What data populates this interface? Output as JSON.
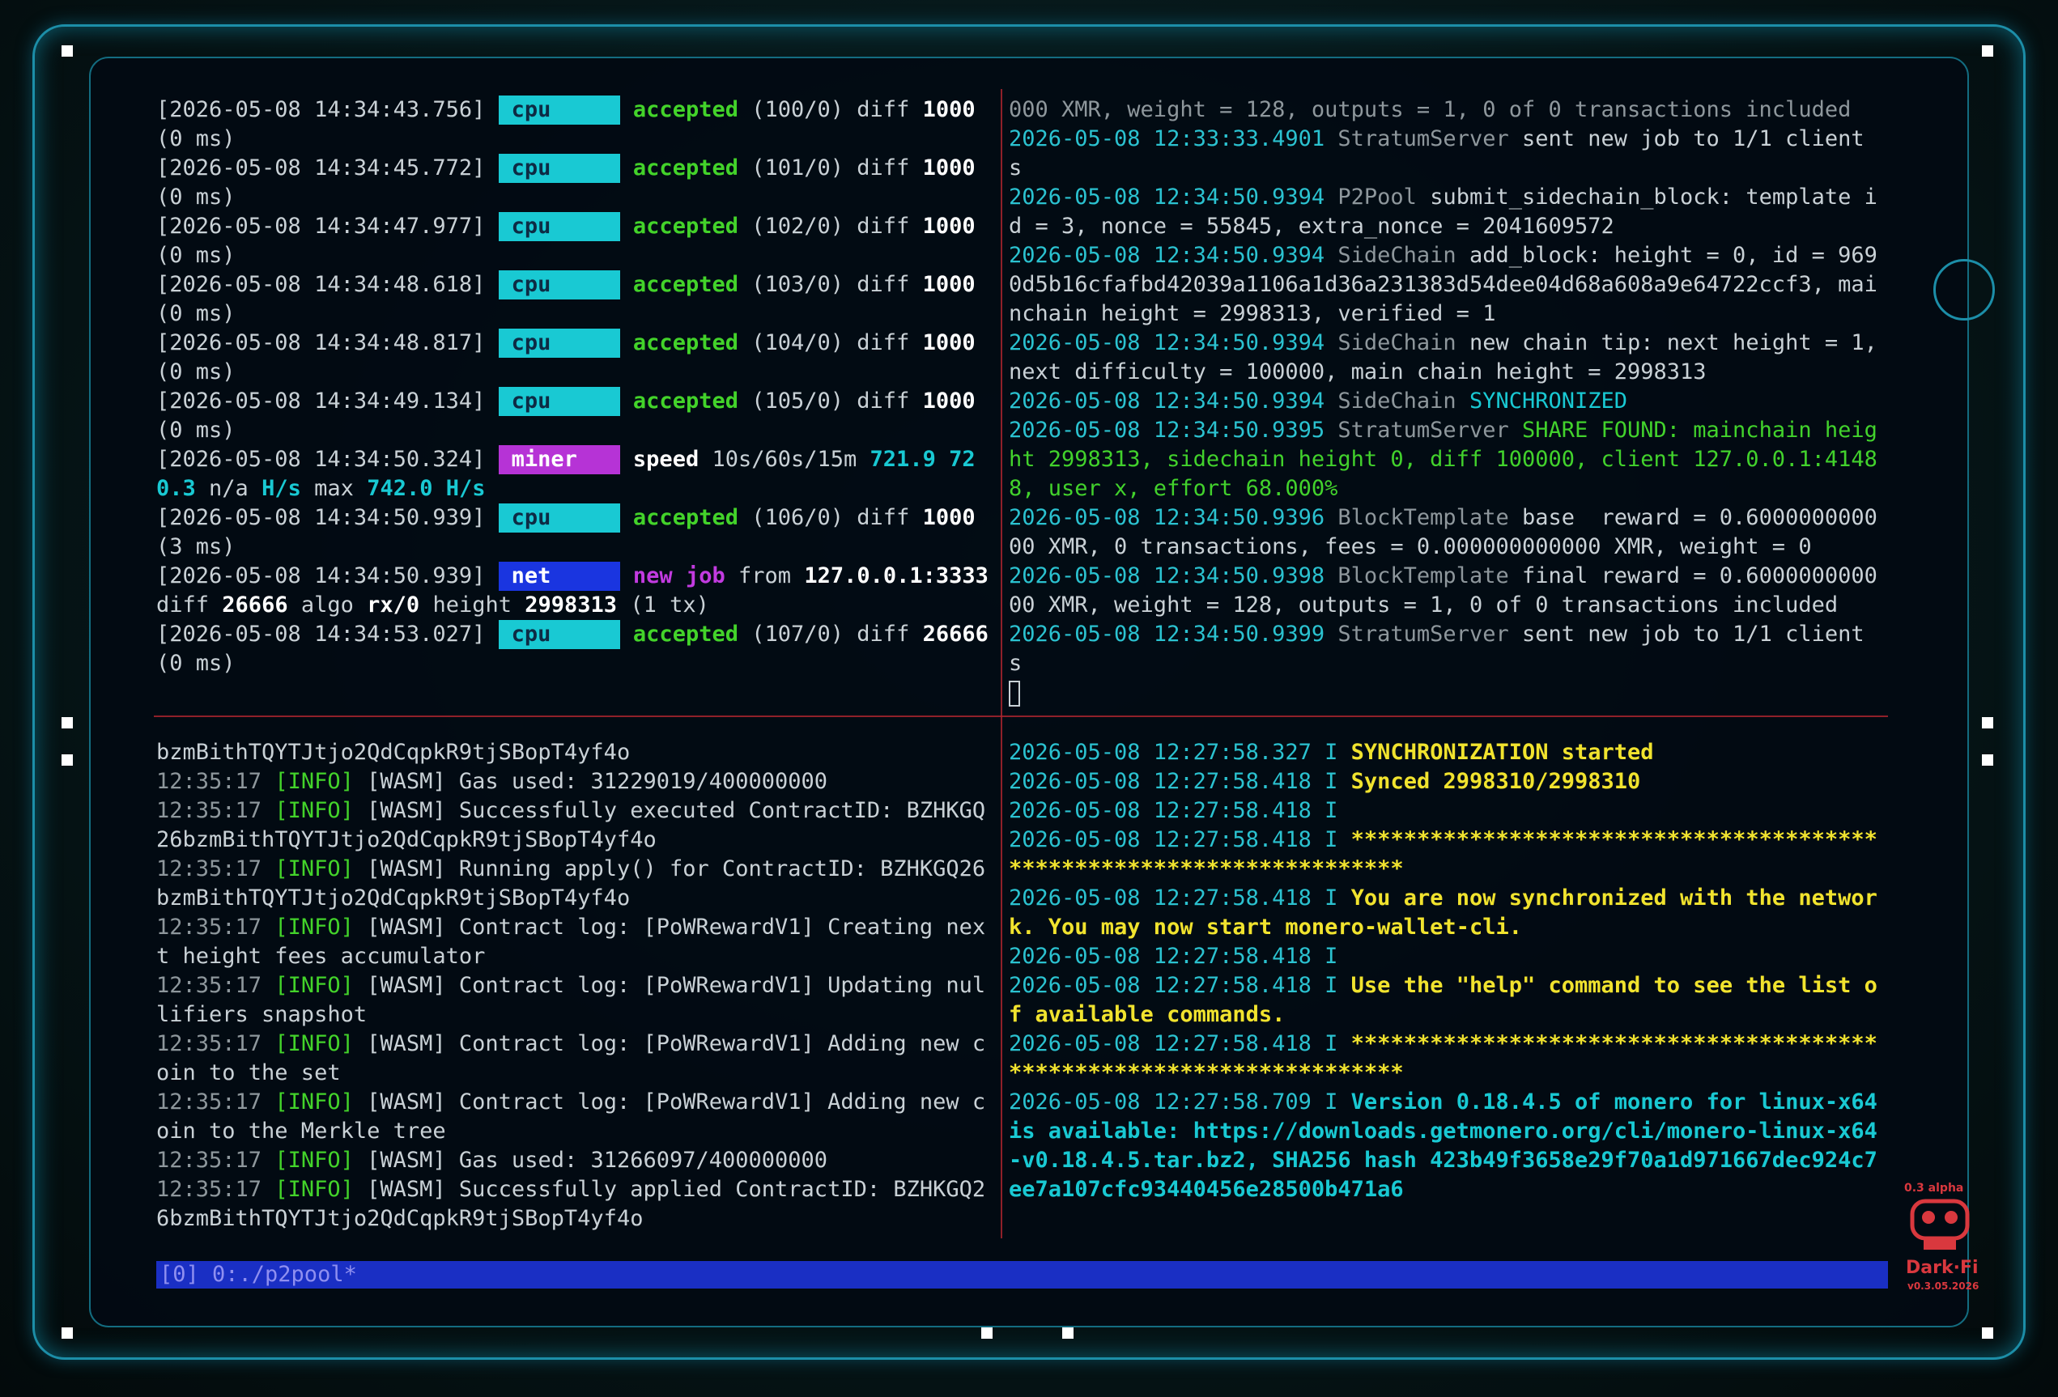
{
  "window": {
    "statusbar": "[0] 0:./p2pool*",
    "logo": {
      "version_top": "0.3 alpha",
      "brand": "Dark·Fi",
      "version_bottom": "v0.3.05.2026"
    }
  },
  "xmrig": {
    "lines": [
      {
        "kind": "accepted",
        "ts": "[2026-05-08 14:34:43.756]",
        "tag": "cpu",
        "label": "accepted",
        "count": "(100/0)",
        "diff_label": "diff",
        "diff": "1000",
        "latency": "(0 ms)"
      },
      {
        "kind": "accepted",
        "ts": "[2026-05-08 14:34:45.772]",
        "tag": "cpu",
        "label": "accepted",
        "count": "(101/0)",
        "diff_label": "diff",
        "diff": "1000",
        "latency": "(0 ms)"
      },
      {
        "kind": "accepted",
        "ts": "[2026-05-08 14:34:47.977]",
        "tag": "cpu",
        "label": "accepted",
        "count": "(102/0)",
        "diff_label": "diff",
        "diff": "1000",
        "latency": "(0 ms)"
      },
      {
        "kind": "accepted",
        "ts": "[2026-05-08 14:34:48.618]",
        "tag": "cpu",
        "label": "accepted",
        "count": "(103/0)",
        "diff_label": "diff",
        "diff": "1000",
        "latency": "(0 ms)"
      },
      {
        "kind": "accepted",
        "ts": "[2026-05-08 14:34:48.817]",
        "tag": "cpu",
        "label": "accepted",
        "count": "(104/0)",
        "diff_label": "diff",
        "diff": "1000",
        "latency": "(0 ms)"
      },
      {
        "kind": "accepted",
        "ts": "[2026-05-08 14:34:49.134]",
        "tag": "cpu",
        "label": "accepted",
        "count": "(105/0)",
        "diff_label": "diff",
        "diff": "1000",
        "latency": "(0 ms)"
      },
      {
        "kind": "speed",
        "ts": "[2026-05-08 14:34:50.324]",
        "tag": "miner",
        "label": "speed",
        "windows": "10s/60s/15m",
        "v1": "721.9",
        "v2": "720.3",
        "v3": "n/a",
        "unit": "H/s",
        "max_label": "max",
        "max": "742.0 H/s"
      },
      {
        "kind": "accepted",
        "ts": "[2026-05-08 14:34:50.939]",
        "tag": "cpu",
        "label": "accepted",
        "count": "(106/0)",
        "diff_label": "diff",
        "diff": "1000",
        "latency": "(3 ms)"
      },
      {
        "kind": "newjob",
        "ts": "[2026-05-08 14:34:50.939]",
        "tag": "net",
        "new": "new",
        "job": "job",
        "from": "from",
        "host": "127.0.0.1:3333",
        "diff_label": "diff",
        "diff": "26666",
        "algo_label": "algo",
        "algo": "rx/0",
        "height_label": "height",
        "height": "2998313",
        "tx": "(1 tx)"
      },
      {
        "kind": "accepted",
        "ts": "[2026-05-08 14:34:53.027]",
        "tag": "cpu",
        "label": "accepted",
        "count": "(107/0)",
        "diff_label": "diff",
        "diff": "26666",
        "latency": "(0 ms)"
      }
    ]
  },
  "p2pool": {
    "lines": [
      {
        "parts": [
          [
            "p2-dim",
            "000 XMR, weight = 128, outputs = 1, 0 of 0 transactions included"
          ]
        ]
      },
      {
        "parts": [
          [
            "p2-ts",
            "2026-05-08 12:33:33.4901 "
          ],
          [
            "p2-mod",
            "StratumServer "
          ],
          [
            "",
            "sent new job to 1/1 client"
          ]
        ]
      },
      {
        "parts": [
          [
            "",
            "s"
          ]
        ]
      },
      {
        "parts": [
          [
            "p2-ts",
            "2026-05-08 12:34:50.9394 "
          ],
          [
            "p2-mod",
            "P2Pool "
          ],
          [
            "",
            "submit_sidechain_block: template id = 3, nonce = 55845, extra_nonce = 2041609572"
          ]
        ]
      },
      {
        "parts": [
          [
            "p2-ts",
            "2026-05-08 12:34:50.9394 "
          ],
          [
            "p2-mod",
            "SideChain "
          ],
          [
            "",
            "add_block: height = 0, id = 9690d5b16cfafbd42039a1106a1d36a231383d54dee04d68a608a9e64722ccf3, mainchain height = 2998313, verified = 1"
          ]
        ]
      },
      {
        "parts": [
          [
            "p2-ts",
            "2026-05-08 12:34:50.9394 "
          ],
          [
            "p2-mod",
            "SideChain "
          ],
          [
            "",
            "new chain tip: next height = 1, next difficulty = 100000, main chain height = 2998313"
          ]
        ]
      },
      {
        "parts": [
          [
            "p2-ts",
            "2026-05-08 12:34:50.9394 "
          ],
          [
            "p2-mod",
            "SideChain "
          ],
          [
            "p2-syn",
            "SYNCHRONIZED"
          ]
        ]
      },
      {
        "parts": [
          [
            "p2-ts",
            "2026-05-08 12:34:50.9395 "
          ],
          [
            "p2-mod",
            "StratumServer "
          ],
          [
            "p2-share",
            "SHARE FOUND: mainchain height 2998313, sidechain height 0, diff 100000, client 127.0.0.1:41488, user x, effort 68.000%"
          ]
        ]
      },
      {
        "parts": [
          [
            "p2-ts",
            "2026-05-08 12:34:50.9396 "
          ],
          [
            "p2-mod",
            "BlockTemplate "
          ],
          [
            "",
            "base  reward = 0.600000000000 XMR, 0 transactions, fees = 0.000000000000 XMR, weight = 0"
          ]
        ]
      },
      {
        "parts": [
          [
            "p2-ts",
            "2026-05-08 12:34:50.9398 "
          ],
          [
            "p2-mod",
            "BlockTemplate "
          ],
          [
            "",
            "final reward = 0.600000000000 XMR, weight = 128, outputs = 1, 0 of 0 transactions included"
          ]
        ]
      },
      {
        "parts": [
          [
            "p2-ts",
            "2026-05-08 12:34:50.9399 "
          ],
          [
            "p2-mod",
            "StratumServer "
          ],
          [
            "",
            "sent new job to 1/1 client"
          ]
        ]
      },
      {
        "parts": [
          [
            "",
            "s"
          ]
        ]
      }
    ]
  },
  "darkfid": {
    "lines": [
      {
        "time": "",
        "level": "",
        "msg": "bzmBithTQYTJtjo2QdCqpkR9tjSBopT4yf4o"
      },
      {
        "time": "12:35:17",
        "level": "[INFO]",
        "msg": "[WASM] Gas used: 31229019/400000000"
      },
      {
        "time": "12:35:17",
        "level": "[INFO]",
        "msg": "[WASM] Successfully executed ContractID: BZHKGQ26bzmBithTQYTJtjo2QdCqpkR9tjSBopT4yf4o"
      },
      {
        "time": "12:35:17",
        "level": "[INFO]",
        "msg": "[WASM] Running apply() for ContractID: BZHKGQ26bzmBithTQYTJtjo2QdCqpkR9tjSBopT4yf4o"
      },
      {
        "time": "12:35:17",
        "level": "[INFO]",
        "msg": "[WASM] Contract log: [PoWRewardV1] Creating next height fees accumulator"
      },
      {
        "time": "12:35:17",
        "level": "[INFO]",
        "msg": "[WASM] Contract log: [PoWRewardV1] Updating nullifiers snapshot"
      },
      {
        "time": "12:35:17",
        "level": "[INFO]",
        "msg": "[WASM] Contract log: [PoWRewardV1] Adding new coin to the set"
      },
      {
        "time": "12:35:17",
        "level": "[INFO]",
        "msg": "[WASM] Contract log: [PoWRewardV1] Adding new coin to the Merkle tree"
      },
      {
        "time": "12:35:17",
        "level": "[INFO]",
        "msg": "[WASM] Gas used: 31266097/400000000"
      },
      {
        "time": "12:35:17",
        "level": "[INFO]",
        "msg": "[WASM] Successfully applied ContractID: BZHKGQ26bzmBithTQYTJtjo2QdCqpkR9tjSBopT4yf4o"
      }
    ]
  },
  "monerod": {
    "lines": [
      {
        "ts": "2026-05-08 12:27:58.327",
        "lvl": "I",
        "msg": "SYNCHRONIZATION started",
        "style": "mn-msg"
      },
      {
        "ts": "2026-05-08 12:27:58.418",
        "lvl": "I",
        "msg": "Synced 2998310/2998310",
        "style": "mn-msg"
      },
      {
        "ts": "2026-05-08 12:27:58.418",
        "lvl": "I",
        "msg": "",
        "style": "mn-msg"
      },
      {
        "ts": "2026-05-08 12:27:58.418",
        "lvl": "I",
        "msg": "**********************************************************************",
        "style": "mn-msg"
      },
      {
        "ts": "2026-05-08 12:27:58.418",
        "lvl": "I",
        "msg": "You are now synchronized with the network. You may now start monero-wallet-cli.",
        "style": "mn-msg"
      },
      {
        "ts": "2026-05-08 12:27:58.418",
        "lvl": "I",
        "msg": "",
        "style": "mn-msg"
      },
      {
        "ts": "2026-05-08 12:27:58.418",
        "lvl": "I",
        "msg": "Use the \"help\" command to see the list of available commands.",
        "style": "mn-msg"
      },
      {
        "ts": "2026-05-08 12:27:58.418",
        "lvl": "I",
        "msg": "**********************************************************************",
        "style": "mn-msg"
      },
      {
        "ts": "2026-05-08 12:27:58.709",
        "lvl": "I",
        "msg": "Version 0.18.4.5 of monero for linux-x64 is available: https://downloads.getmonero.org/cli/monero-linux-x64-v0.18.4.5.tar.bz2, SHA256 hash 423b49f3658e29f70a1d971667dec924c7ee7a107cfc93440456e28500b471a6",
        "style": "mn-ver"
      }
    ]
  }
}
